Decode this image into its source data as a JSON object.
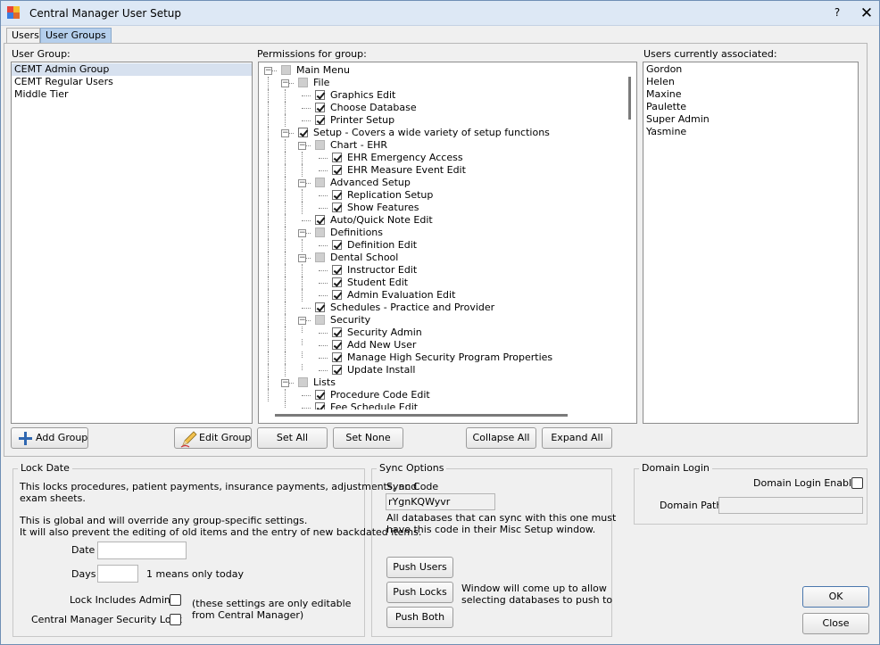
{
  "window": {
    "title": "Central Manager User Setup",
    "help_glyph": "?",
    "close_glyph": "✕"
  },
  "tabs": [
    {
      "label": "Users"
    },
    {
      "label": "User Groups"
    }
  ],
  "user_group": {
    "label": "User Group:",
    "items": [
      "CEMT Admin Group",
      "CEMT Regular Users",
      "Middle Tier"
    ],
    "selected": "CEMT Admin Group",
    "add_button": "Add Group",
    "edit_button": "Edit Group"
  },
  "permissions": {
    "label": "Permissions for group:",
    "tree": [
      {
        "depth": 0,
        "label": "Main Menu",
        "state": "indeterminate",
        "expanded": true
      },
      {
        "depth": 1,
        "label": "File",
        "state": "indeterminate",
        "expanded": true
      },
      {
        "depth": 2,
        "label": "Graphics Edit",
        "state": "checked"
      },
      {
        "depth": 2,
        "label": "Choose Database",
        "state": "checked"
      },
      {
        "depth": 2,
        "label": "Printer Setup",
        "state": "checked"
      },
      {
        "depth": 1,
        "label": "Setup - Covers a wide variety of setup functions",
        "state": "checked",
        "expanded": true
      },
      {
        "depth": 2,
        "label": "Chart - EHR",
        "state": "indeterminate",
        "expanded": true
      },
      {
        "depth": 3,
        "label": "EHR Emergency Access",
        "state": "checked"
      },
      {
        "depth": 3,
        "label": "EHR Measure Event Edit",
        "state": "checked"
      },
      {
        "depth": 2,
        "label": "Advanced Setup",
        "state": "indeterminate",
        "expanded": true
      },
      {
        "depth": 3,
        "label": "Replication Setup",
        "state": "checked"
      },
      {
        "depth": 3,
        "label": "Show Features",
        "state": "checked"
      },
      {
        "depth": 2,
        "label": "Auto/Quick Note Edit",
        "state": "checked"
      },
      {
        "depth": 2,
        "label": "Definitions",
        "state": "indeterminate",
        "expanded": true
      },
      {
        "depth": 3,
        "label": "Definition Edit",
        "state": "checked"
      },
      {
        "depth": 2,
        "label": "Dental School",
        "state": "indeterminate",
        "expanded": true
      },
      {
        "depth": 3,
        "label": "Instructor Edit",
        "state": "checked"
      },
      {
        "depth": 3,
        "label": "Student Edit",
        "state": "checked"
      },
      {
        "depth": 3,
        "label": "Admin Evaluation Edit",
        "state": "checked"
      },
      {
        "depth": 2,
        "label": "Schedules - Practice and Provider",
        "state": "checked"
      },
      {
        "depth": 2,
        "label": "Security",
        "state": "indeterminate",
        "expanded": true
      },
      {
        "depth": 3,
        "label": "Security Admin",
        "state": "checked"
      },
      {
        "depth": 3,
        "label": "Add New User",
        "state": "checked"
      },
      {
        "depth": 3,
        "label": "Manage High Security Program Properties",
        "state": "checked"
      },
      {
        "depth": 3,
        "label": "Update Install",
        "state": "checked"
      },
      {
        "depth": 1,
        "label": "Lists",
        "state": "indeterminate",
        "expanded": true
      },
      {
        "depth": 2,
        "label": "Procedure Code Edit",
        "state": "checked"
      },
      {
        "depth": 2,
        "label": "Fee Schedule Edit",
        "state": "checked"
      }
    ],
    "buttons": {
      "set_all": "Set All",
      "set_none": "Set None",
      "collapse_all": "Collapse All",
      "expand_all": "Expand All"
    }
  },
  "users_associated": {
    "label": "Users currently associated:",
    "items": [
      "Gordon",
      "Helen",
      "Maxine",
      "Paulette",
      "Super Admin",
      "Yasmine"
    ]
  },
  "lock_date": {
    "title": "Lock Date",
    "desc1": "This locks procedures, patient payments, insurance payments, adjustments, and",
    "desc2": "exam sheets.",
    "desc3": "This is global and will override any group-specific settings.",
    "desc4": "It will also prevent the editing of old items and the entry of new backdated items.",
    "date_label": "Date",
    "date_value": "",
    "days_label": "Days",
    "days_value": "",
    "days_hint": "1 means only today",
    "lock_admins_label": "Lock Includes Admins",
    "lock_admins_checked": false,
    "cm_security_label": "Central Manager Security Lock",
    "cm_security_checked": false,
    "note1": "(these settings are only editable",
    "note2": "from Central Manager)"
  },
  "sync_options": {
    "title": "Sync Options",
    "code_label": "Sync Code",
    "code_value": "rYgnKQWyvr",
    "desc1": "All databases that can sync with this one must",
    "desc2": "have this code in their Misc Setup window.",
    "push_users": "Push Users",
    "push_locks": "Push Locks",
    "push_both": "Push Both",
    "window_note1": "Window will come up to allow",
    "window_note2": "selecting databases to push to"
  },
  "domain_login": {
    "title": "Domain Login",
    "enabled_label": "Domain Login Enabled",
    "enabled_checked": false,
    "path_label": "Domain Path",
    "path_value": ""
  },
  "footer": {
    "ok": "OK",
    "close": "Close"
  },
  "colors": {
    "titlebar": "#dde8f5",
    "active_tab": "#b5cfec",
    "selection": "#d7e1ef",
    "add_icon": "#2f67b1"
  },
  "icons": {
    "app": "app-icon",
    "add": "plus-icon",
    "edit": "pencil-icon"
  }
}
